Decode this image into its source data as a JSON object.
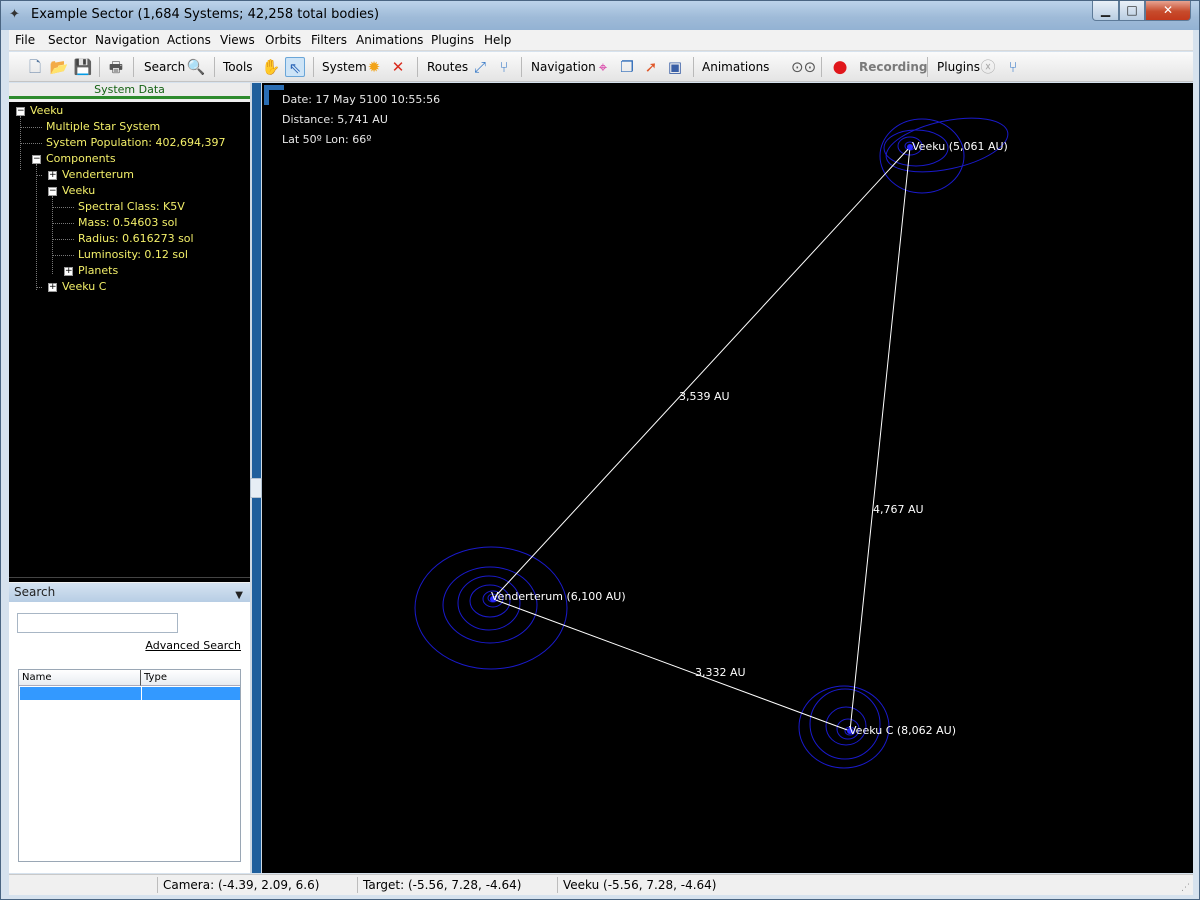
{
  "window": {
    "title": "Example Sector (1,684 Systems; 42,258 total bodies)",
    "app_icon": "constellation-icon",
    "controls": [
      "minimize-icon",
      "maximize-icon",
      "close-icon"
    ]
  },
  "menu": [
    "File",
    "Sector",
    "Navigation",
    "Actions",
    "Views",
    "Orbits",
    "Filters",
    "Animations",
    "Plugins",
    "Help"
  ],
  "toolbar": {
    "search_label": "Search",
    "tools_label": "Tools",
    "system_label": "System",
    "routes_label": "Routes",
    "navigation_label": "Navigation",
    "animations_label": "Animations",
    "recording_label": "Recording",
    "plugins_label": "Plugins",
    "icons": [
      "new-file-icon",
      "open-folder-icon",
      "save-icon",
      "print-icon",
      "magnifier-icon",
      "hand-pan-icon",
      "pointer-select-icon",
      "sun-icon",
      "delete-x-icon",
      "route-link-icon",
      "route-branch-icon",
      "crosshair-target-icon",
      "window-cube-icon",
      "arrow-out-icon",
      "zoom-region-icon",
      "binoculars-icon",
      "record-icon",
      "disabled-x-icon",
      "plugin-branch-icon"
    ]
  },
  "left_panel": {
    "header": "System Data",
    "tree": {
      "root": "Veeku",
      "multiple": "Multiple Star System",
      "population": "System Population: 402,694,397",
      "components": "Components",
      "venderterum": "Venderterum",
      "veeku": "Veeku",
      "spectral": "Spectral Class: K5V",
      "mass": "Mass: 0.54603 sol",
      "radius": "Radius: 0.616273 sol",
      "luminosity": "Luminosity: 0.12 sol",
      "planets": "Planets",
      "veeku_c": "Veeku C"
    },
    "search": {
      "header": "Search",
      "input_value": "",
      "advanced": "Advanced Search",
      "columns": [
        "Name",
        "Type"
      ]
    }
  },
  "viewport": {
    "date": "Date: 17 May 5100 10:55:56",
    "distance": "Distance: 5,741 AU",
    "latlon": "Lat 50º Lon: 66º",
    "stars": [
      {
        "label": "Veeku (5,061 AU)"
      },
      {
        "label": "Venderterum (6,100 AU)"
      },
      {
        "label": "Veeku C (8,062 AU)"
      }
    ],
    "distances": [
      "3,539 AU",
      "4,767 AU",
      "3,332 AU"
    ],
    "colors": {
      "orbit": "#1a1acc",
      "line": "#ffffff",
      "text": "#ffffff",
      "background": "#000000"
    }
  },
  "statusbar": {
    "camera": "Camera: (-4.39, 2.09, 6.6)",
    "target": "Target: (-5.56, 7.28, -4.64)",
    "selected": "Veeku (-5.56, 7.28, -4.64)"
  }
}
